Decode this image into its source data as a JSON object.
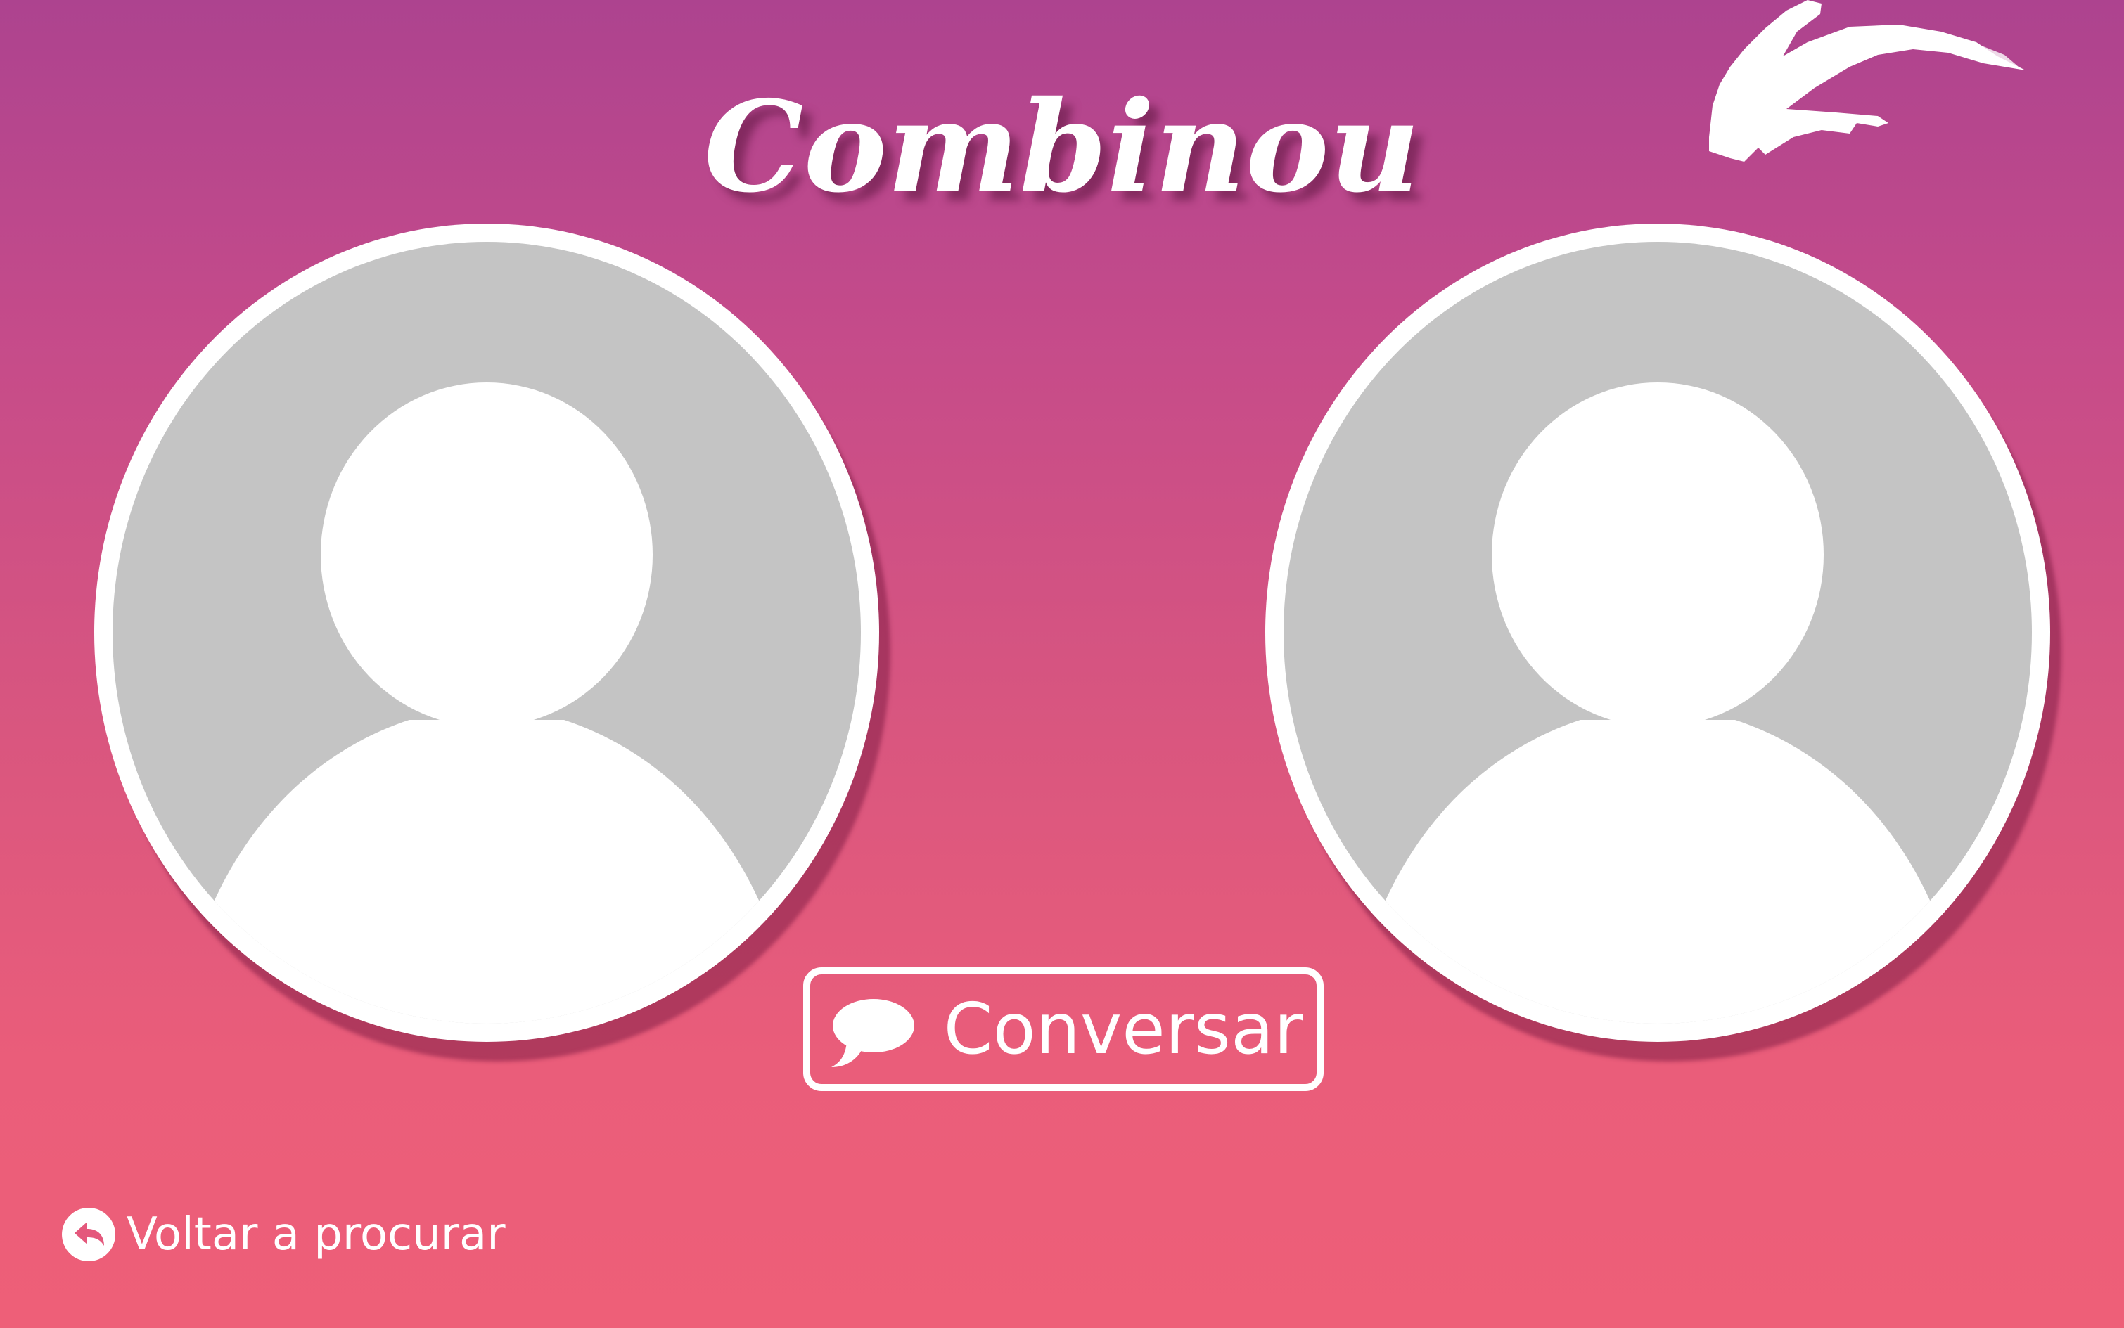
{
  "screen": {
    "title": "Combinou"
  },
  "profiles": [
    {
      "icon": "user-placeholder-icon"
    },
    {
      "icon": "user-placeholder-icon"
    }
  ],
  "actions": {
    "chat_label": "Conversar",
    "chat_icon": "speech-bubble-icon",
    "back_label": "Voltar a procurar",
    "back_icon": "undo-arrow-icon",
    "close_icon": "brush-arrow-left-icon"
  },
  "colors": {
    "gradient_top": "#ad438f",
    "gradient_bottom": "#ee5f78",
    "avatar_bg": "#c4c4c4",
    "foreground": "#ffffff"
  }
}
